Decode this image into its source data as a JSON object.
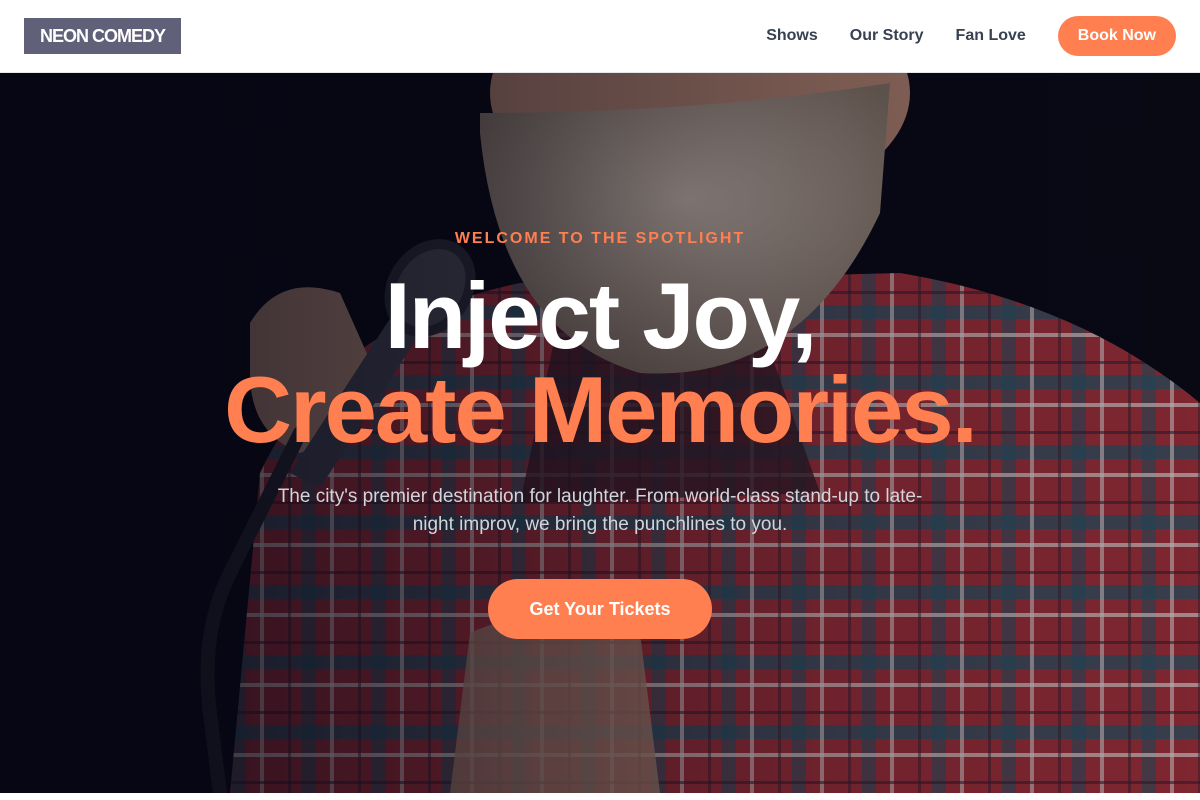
{
  "header": {
    "logo_text": "NEON COMEDY",
    "nav": [
      {
        "label": "Shows"
      },
      {
        "label": "Our Story"
      },
      {
        "label": "Fan Love"
      }
    ],
    "book_button": "Book Now"
  },
  "hero": {
    "eyebrow": "WELCOME TO THE SPOTLIGHT",
    "headline_line1": "Inject Joy,",
    "headline_line2": "Create Memories.",
    "subtext": "The city's premier destination for laughter. From world-class stand-up to late-night improv, we bring the punchlines to you.",
    "cta": "Get Your Tickets"
  },
  "colors": {
    "accent": "#ff7f50",
    "logo_bg": "#606078",
    "nav_text": "#374151",
    "hero_bg": "#0a0a14"
  }
}
